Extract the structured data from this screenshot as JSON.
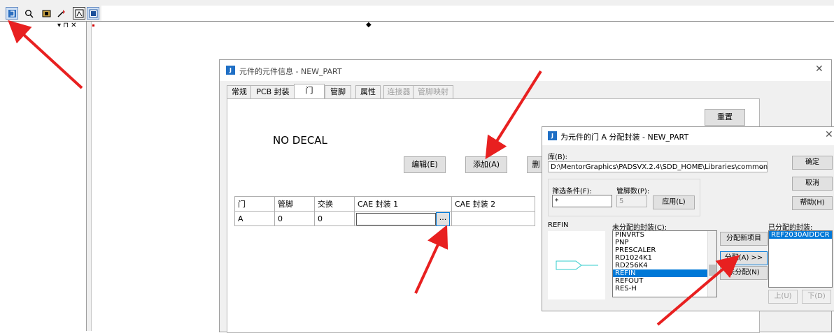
{
  "toolbar": {
    "icons": [
      "part-icon",
      "zoom-icon",
      "decal-icon",
      "wand-icon",
      "window-icon",
      "window2-icon"
    ]
  },
  "left_panel": {
    "pin": "▾ ⊓ ✕"
  },
  "dialog1": {
    "title": "元件的元件信息 - NEW_PART",
    "tabs": [
      {
        "label": "常规"
      },
      {
        "label": "PCB 封装"
      },
      {
        "label": "门"
      },
      {
        "label": "管脚"
      },
      {
        "label": "属性"
      },
      {
        "label": "连接器"
      },
      {
        "label": "管脚映射"
      }
    ],
    "reset_label": "重置",
    "no_decal": "NO DECAL",
    "edit_label": "编辑(E)",
    "add_label": "添加(A)",
    "delete_label": "删",
    "grid": {
      "headers": [
        "门",
        "管脚",
        "交换",
        "CAE 封装 1",
        "CAE 封装 2"
      ],
      "rows": [
        [
          "A",
          "0",
          "0",
          "",
          ""
        ]
      ],
      "browse_label": "..."
    }
  },
  "dialog2": {
    "title": "为元件的门 A 分配封装 - NEW_PART",
    "library_label": "库(B):",
    "library_value": "D:\\MentorGraphics\\PADSVX.2.4\\SDD_HOME\\Libraries\\common",
    "filter_label": "筛选条件(F):",
    "filter_value": "*",
    "pin_count_label": "管脚数(P):",
    "pin_count_value": "5",
    "apply_label": "应用(L)",
    "ok_label": "确定",
    "cancel_label": "取消",
    "help_label": "帮助(H)",
    "preview_label": "REFIN",
    "unassigned_label": "未分配的封装(C):",
    "unassigned_items": [
      "PINVRTS",
      "PNP",
      "PRESCALER",
      "RD1024K1",
      "RD256K4",
      "REFIN",
      "REFOUT",
      "RES-H"
    ],
    "selected_item": "REFIN",
    "assign_new_label": "分配新项目",
    "assign_label": "分配(A) >>",
    "unassign_label": "未分配(N)",
    "assigned_label": "已分配的封装:",
    "assigned_items": [
      "REF2030AIDDCR"
    ],
    "up_label": "上(U)",
    "down_label": "下(D)"
  },
  "colors": {
    "arrow": "#e82020",
    "selection": "#0078d7",
    "preview_shape": "#33cccc"
  }
}
